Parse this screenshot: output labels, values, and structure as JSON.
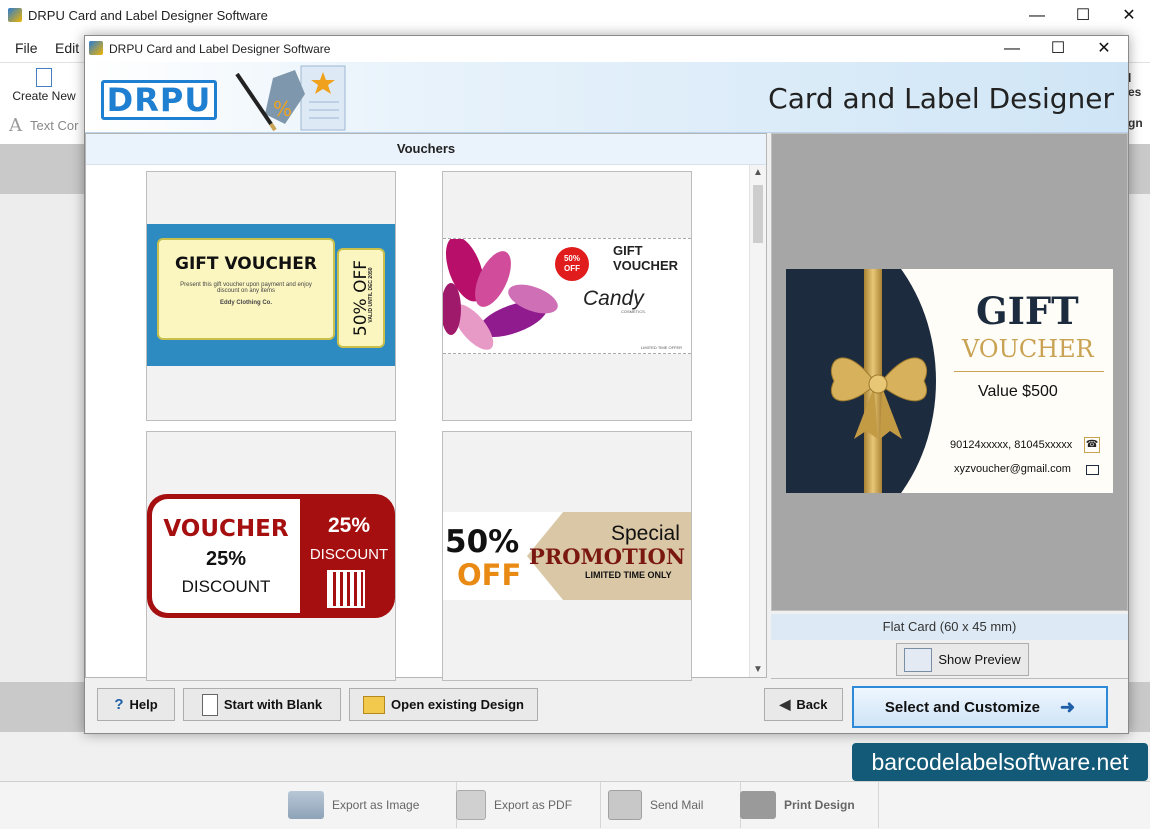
{
  "outer_window": {
    "title": "DRPU Card and Label Designer Software",
    "menu": [
      "File",
      "Edit"
    ],
    "toolbar": {
      "create_new": "Create New",
      "text_partial": "Text Cor",
      "right_partial_1": "l",
      "right_partial_2": "es",
      "right_partial_3": "gn"
    },
    "bottom_bar": {
      "export_image": "Export as Image",
      "export_pdf": "Export as PDF",
      "send_mail": "Send Mail",
      "print_design": "Print Design"
    }
  },
  "dialog": {
    "title": "DRPU Card and Label Designer Software",
    "banner": {
      "logo_text": "DRPU",
      "app_title": "Card and Label Designer"
    },
    "templates": {
      "category": "Vouchers",
      "items": [
        {
          "title": "GIFT VOUCHER",
          "body": "Present this gift voucher upon payment and enjoy discount on any items",
          "company": "Eddy Clothing Co.",
          "offer": "50% OFF",
          "valid": "VALID UNTIL DEC 2050"
        },
        {
          "badge": "50% OFF",
          "title_line1": "GIFT",
          "title_line2": "VOUCHER",
          "brand": "Candy",
          "brand_sub": "COSMETICS.",
          "footer": "LIMITED TIME OFFER"
        },
        {
          "title": "VOUCHER",
          "left_value": "25%",
          "left_label": "DISCOUNT",
          "right_value": "25%",
          "right_label": "DISCOUNT"
        },
        {
          "value": "50%",
          "off": "OFF",
          "special": "Special",
          "promotion": "PROMOTION",
          "limited": "LIMITED TIME ONLY"
        }
      ]
    },
    "preview": {
      "gift": "GIFT",
      "voucher": "VOUCHER",
      "value": "Value $500",
      "phone": "90124xxxxx, 81045xxxxx",
      "email": "xyzvoucher@gmail.com",
      "caption": "Flat Card (60 x 45 mm)",
      "show_preview": "Show Preview"
    },
    "buttons": {
      "help": "Help",
      "start_blank": "Start with Blank",
      "open_existing": "Open existing Design",
      "back": "Back",
      "select_customize": "Select and Customize"
    }
  },
  "watermark": "barcodelabelsoftware.net",
  "colors": {
    "accent_blue": "#1f7fd0",
    "voucher_red": "#a50f0f",
    "promo_orange": "#e88a14",
    "gold": "#c9a253",
    "navy": "#1d2b3e"
  }
}
